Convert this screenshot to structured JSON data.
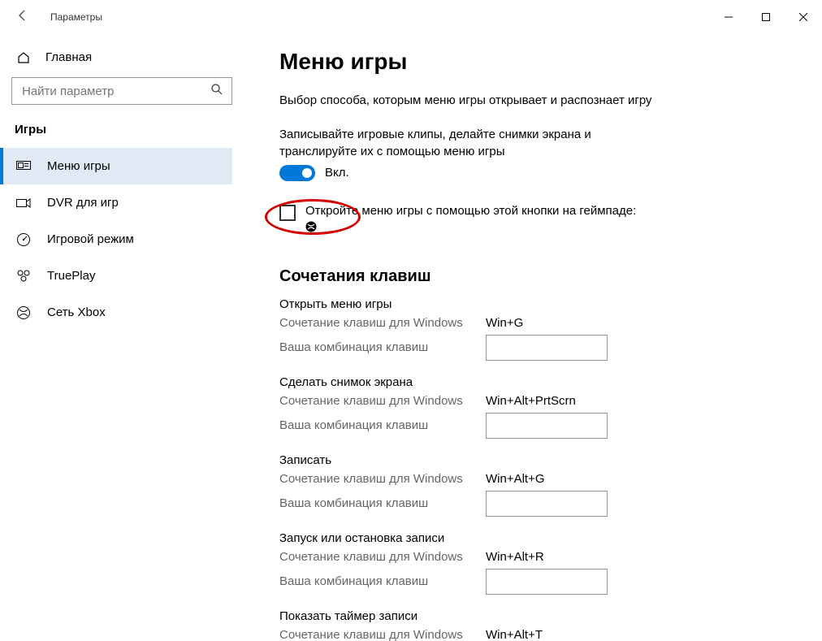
{
  "window": {
    "title": "Параметры"
  },
  "sidebar": {
    "home": "Главная",
    "search_placeholder": "Найти параметр",
    "category": "Игры",
    "items": [
      {
        "label": "Меню игры"
      },
      {
        "label": "DVR для игр"
      },
      {
        "label": "Игровой режим"
      },
      {
        "label": "TruePlay"
      },
      {
        "label": "Сеть Xbox"
      }
    ]
  },
  "page": {
    "title": "Меню игры",
    "description": "Выбор способа, которым меню игры открывает и распознает игру",
    "toggle_desc": "Записывайте игровые клипы, делайте снимки экрана и транслируйте их с помощью меню игры",
    "toggle_label": "Вкл.",
    "checkbox_label": "Откройте меню игры с помощью этой кнопки на геймпаде:",
    "section_title": "Сочетания клавиш",
    "windows_shortcut_label": "Сочетание клавиш для Windows",
    "custom_shortcut_label": "Ваша комбинация клавиш",
    "shortcuts": [
      {
        "title": "Открыть меню игры",
        "win": "Win+G",
        "custom": ""
      },
      {
        "title": "Сделать снимок экрана",
        "win": "Win+Alt+PrtScrn",
        "custom": ""
      },
      {
        "title": "Записать",
        "win": "Win+Alt+G",
        "custom": ""
      },
      {
        "title": "Запуск или остановка записи",
        "win": "Win+Alt+R",
        "custom": ""
      },
      {
        "title": "Показать таймер записи",
        "win": "Win+Alt+T",
        "custom": ""
      }
    ]
  }
}
